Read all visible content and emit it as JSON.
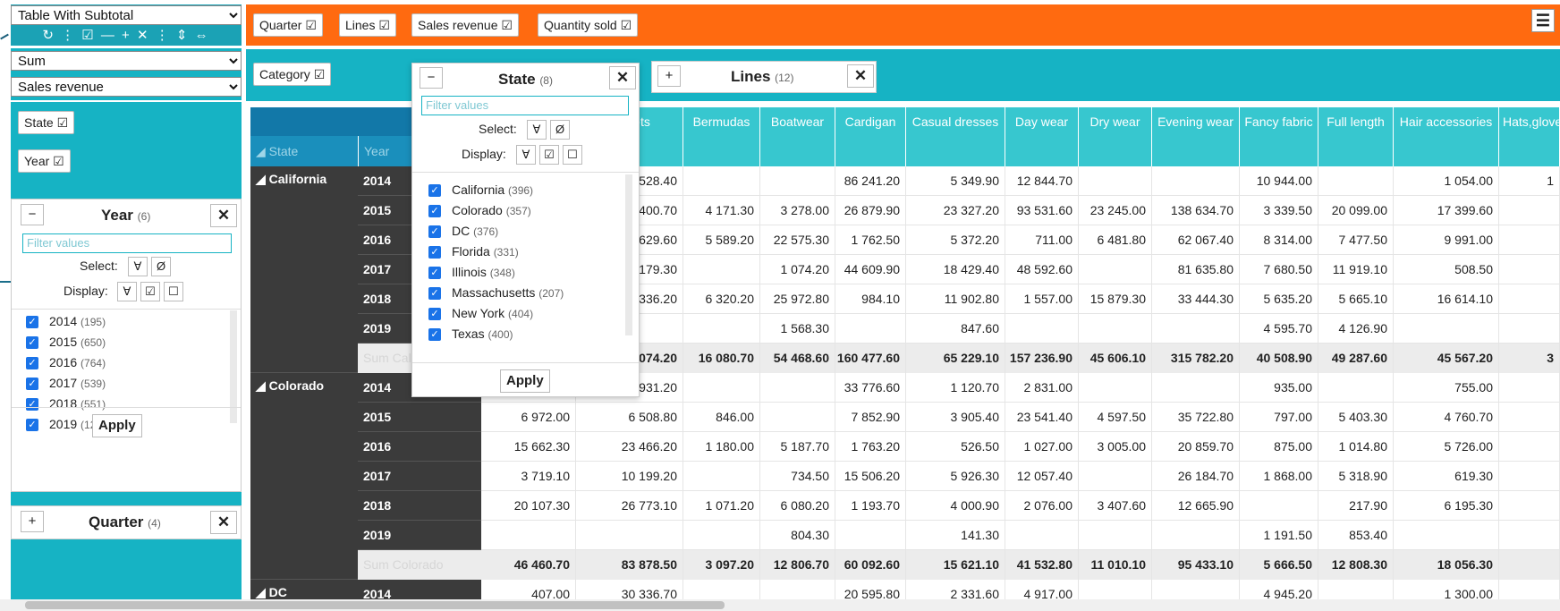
{
  "colors": {
    "accent_orange": "#ff6a10",
    "accent_teal": "#16b3c4",
    "header_teal": "#37c7cf",
    "dark_row": "#3b3b3b",
    "checkbox_blue": "#1a73e8"
  },
  "view_select": {
    "value": "Table With Subtotal"
  },
  "view_toolbar": {
    "icons": "↻ ⋮ ☑ — + ✕ ⋮ ⇕ ⇔"
  },
  "aggregator_select": {
    "value": "Sum"
  },
  "value_select": {
    "value": "Sales revenue"
  },
  "unused_attrs": [
    {
      "label": "Quarter ☑"
    },
    {
      "label": "Lines ☑"
    },
    {
      "label": "Sales revenue ☑"
    },
    {
      "label": "Quantity sold ☑"
    }
  ],
  "col_attrs": [
    {
      "label": "Category ☑"
    }
  ],
  "row_attrs": [
    {
      "label": "State ☑"
    },
    {
      "label": "Year ☑"
    }
  ],
  "menu_icon": "☰",
  "lines_panel": {
    "plus": "+",
    "title": "Lines",
    "count": "(12)",
    "close": "✕"
  },
  "quarter_panel": {
    "plus": "+",
    "title": "Quarter",
    "count": "(4)",
    "close": "✕"
  },
  "state_panel": {
    "minus": "−",
    "title": "State",
    "count": "(8)",
    "close": "✕",
    "filter_placeholder": "Filter values",
    "select_label": "Select:",
    "select_all": "∀",
    "select_none": "Ø",
    "display_label": "Display:",
    "display_all": "∀",
    "display_checked": "☑",
    "display_unchecked": "☐",
    "items": [
      {
        "name": "California",
        "count": "(396)"
      },
      {
        "name": "Colorado",
        "count": "(357)"
      },
      {
        "name": "DC",
        "count": "(376)"
      },
      {
        "name": "Florida",
        "count": "(331)"
      },
      {
        "name": "Illinois",
        "count": "(348)"
      },
      {
        "name": "Massachusetts",
        "count": "(207)"
      },
      {
        "name": "New York",
        "count": "(404)"
      },
      {
        "name": "Texas",
        "count": "(400)"
      }
    ],
    "apply": "Apply"
  },
  "year_panel": {
    "minus": "−",
    "title": "Year",
    "count": "(6)",
    "close": "✕",
    "filter_placeholder": "Filter values",
    "select_label": "Select:",
    "select_all": "∀",
    "select_none": "Ø",
    "display_label": "Display:",
    "display_all": "∀",
    "display_checked": "☑",
    "display_unchecked": "☐",
    "items": [
      {
        "name": "2014",
        "count": "(195)"
      },
      {
        "name": "2015",
        "count": "(650)"
      },
      {
        "name": "2016",
        "count": "(764)"
      },
      {
        "name": "2017",
        "count": "(539)"
      },
      {
        "name": "2018",
        "count": "(551)"
      },
      {
        "name": "2019",
        "count": "(120)"
      }
    ],
    "apply": "Apply"
  },
  "table": {
    "row_header_state": "◢ State",
    "row_header_year": "Year",
    "columns": [
      "",
      ",wallets",
      "Bermudas",
      "Boatwear",
      "Cardigan",
      "Casual dresses",
      "Day wear",
      "Dry wear",
      "Evening wear",
      "Fancy fabric",
      "Full length",
      "Hair accessories",
      "Hats,glove"
    ],
    "groups": [
      {
        "state": "◢ California",
        "rows": [
          {
            "year": "2014",
            "cells": [
              "",
              "528.40",
              "",
              "",
              "86 241.20",
              "5 349.90",
              "12 844.70",
              "",
              "",
              "10 944.00",
              "",
              "1 054.00",
              "1"
            ]
          },
          {
            "year": "2015",
            "cells": [
              "",
              "400.70",
              "4 171.30",
              "3 278.00",
              "26 879.90",
              "23 327.20",
              "93 531.60",
              "23 245.00",
              "138 634.70",
              "3 339.50",
              "20 099.00",
              "17 399.60",
              ""
            ]
          },
          {
            "year": "2016",
            "cells": [
              "",
              "629.60",
              "5 589.20",
              "22 575.30",
              "1 762.50",
              "5 372.20",
              "711.00",
              "6 481.80",
              "62 067.40",
              "8 314.00",
              "7 477.50",
              "9 991.00",
              ""
            ]
          },
          {
            "year": "2017",
            "cells": [
              "",
              "179.30",
              "",
              "1 074.20",
              "44 609.90",
              "18 429.40",
              "48 592.60",
              "",
              "81 635.80",
              "7 680.50",
              "11 919.10",
              "508.50",
              ""
            ]
          },
          {
            "year": "2018",
            "cells": [
              "",
              "336.20",
              "6 320.20",
              "25 972.80",
              "984.10",
              "11 902.80",
              "1 557.00",
              "15 879.30",
              "33 444.30",
              "5 635.20",
              "5 665.10",
              "16 614.10",
              ""
            ]
          },
          {
            "year": "2019",
            "cells": [
              "",
              "",
              "",
              "1 568.30",
              "",
              "847.60",
              "",
              "",
              "",
              "4 595.70",
              "4 126.90",
              "",
              ""
            ]
          }
        ],
        "sum_label": "Sum California",
        "sum": [
          "",
          "074.20",
          "16 080.70",
          "54 468.60",
          "160 477.60",
          "65 229.10",
          "157 236.90",
          "45 606.10",
          "315 782.20",
          "40 508.90",
          "49 287.60",
          "45 567.20",
          "3"
        ]
      },
      {
        "state": "◢ Colorado",
        "rows": [
          {
            "year": "2014",
            "cells": [
              "",
              "931.20",
              "",
              "",
              "33 776.60",
              "1 120.70",
              "2 831.00",
              "",
              "",
              "935.00",
              "",
              "755.00",
              ""
            ]
          },
          {
            "year": "2015",
            "cells": [
              "6 972.00",
              "6 508.80",
              "846.00",
              "",
              "7 852.90",
              "3 905.40",
              "23 541.40",
              "4 597.50",
              "35 722.80",
              "797.00",
              "5 403.30",
              "4 760.70",
              ""
            ]
          },
          {
            "year": "2016",
            "cells": [
              "15 662.30",
              "23 466.20",
              "1 180.00",
              "5 187.70",
              "1 763.20",
              "526.50",
              "1 027.00",
              "3 005.00",
              "20 859.70",
              "875.00",
              "1 014.80",
              "5 726.00",
              ""
            ]
          },
          {
            "year": "2017",
            "cells": [
              "3 719.10",
              "10 199.20",
              "",
              "734.50",
              "15 506.20",
              "5 926.30",
              "12 057.40",
              "",
              "26 184.70",
              "1 868.00",
              "5 318.90",
              "619.30",
              ""
            ]
          },
          {
            "year": "2018",
            "cells": [
              "20 107.30",
              "26 773.10",
              "1 071.20",
              "6 080.20",
              "1 193.70",
              "4 000.90",
              "2 076.00",
              "3 407.60",
              "12 665.90",
              "",
              "217.90",
              "6 195.30",
              ""
            ]
          },
          {
            "year": "2019",
            "cells": [
              "",
              "",
              "",
              "804.30",
              "",
              "141.30",
              "",
              "",
              "",
              "1 191.50",
              "853.40",
              "",
              ""
            ]
          }
        ],
        "sum_label": "Sum Colorado",
        "sum": [
          "46 460.70",
          "83 878.50",
          "3 097.20",
          "12 806.70",
          "60 092.60",
          "15 621.10",
          "41 532.80",
          "11 010.10",
          "95 433.10",
          "5 666.50",
          "12 808.30",
          "18 056.30",
          ""
        ]
      },
      {
        "state": "◢ DC",
        "rows": [
          {
            "year": "2014",
            "cells": [
              "407.00",
              "30 336.70",
              "",
              "",
              "20 595.80",
              "2 331.60",
              "4 917.00",
              "",
              "",
              "4 945.20",
              "",
              "1 300.00",
              ""
            ]
          }
        ]
      }
    ]
  }
}
